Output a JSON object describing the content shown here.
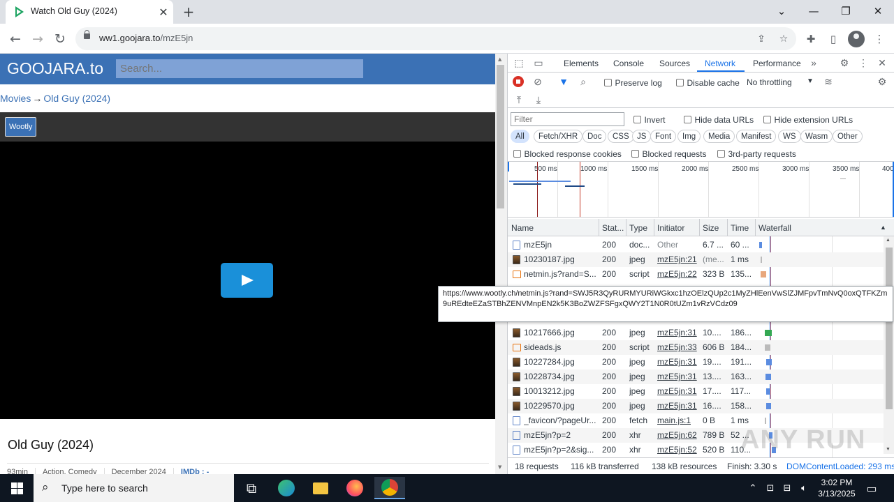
{
  "browser": {
    "tab_title": "Watch Old Guy (2024)",
    "url_host": "ww1.goojara.to",
    "url_path": "/mzE5jn"
  },
  "page": {
    "logo": "GOOJARA.to",
    "search_placeholder": "Search...",
    "breadcrumb_root": "Movies",
    "breadcrumb_arrow": "→",
    "breadcrumb_current": "Old Guy (2024)",
    "server_label": "Wootly",
    "movie_title": "Old Guy (2024)",
    "meta": {
      "runtime": "93min",
      "genres": "Action, Comedy",
      "release": "December 2024",
      "imdb": "IMDb : -"
    }
  },
  "devtools": {
    "tabs": [
      "Elements",
      "Console",
      "Sources",
      "Network",
      "Performance"
    ],
    "active_tab": "Network",
    "preserve_log": "Preserve log",
    "disable_cache": "Disable cache",
    "throttling": "No throttling",
    "filter_placeholder": "Filter",
    "invert": "Invert",
    "hide_data_urls": "Hide data URLs",
    "hide_extension_urls": "Hide extension URLs",
    "type_filters": [
      "All",
      "Fetch/XHR",
      "Doc",
      "CSS",
      "JS",
      "Font",
      "Img",
      "Media",
      "Manifest",
      "WS",
      "Wasm",
      "Other"
    ],
    "blocked_response_cookies": "Blocked response cookies",
    "blocked_requests": "Blocked requests",
    "third_party_requests": "3rd-party requests",
    "timeline_ticks": [
      "500 ms",
      "1000 ms",
      "1500 ms",
      "2000 ms",
      "2500 ms",
      "3000 ms",
      "3500 ms",
      "400"
    ],
    "columns": [
      "Name",
      "Stat...",
      "Type",
      "Initiator",
      "Size",
      "Time",
      "Waterfall"
    ],
    "rows": [
      {
        "name": "mzE5jn",
        "status": "200",
        "type": "doc...",
        "initiator": "Other",
        "size": "6.7 ...",
        "time": "60 ...",
        "icon": "doc"
      },
      {
        "name": "10230187.jpg",
        "status": "200",
        "type": "jpeg",
        "initiator": "mzE5jn:21",
        "size": "(me...",
        "time": "1 ms",
        "icon": "img"
      },
      {
        "name": "netmin.js?rand=S...",
        "status": "200",
        "type": "script",
        "initiator": "mzE5jn:22",
        "size": "323 B",
        "time": "135...",
        "icon": "script"
      },
      {
        "name": "10217666.jpg",
        "status": "200",
        "type": "jpeg",
        "initiator": "mzE5jn:31",
        "size": "10....",
        "time": "186...",
        "icon": "img"
      },
      {
        "name": "sideads.js",
        "status": "200",
        "type": "script",
        "initiator": "mzE5jn:33",
        "size": "606 B",
        "time": "184...",
        "icon": "script"
      },
      {
        "name": "10227284.jpg",
        "status": "200",
        "type": "jpeg",
        "initiator": "mzE5jn:31",
        "size": "19....",
        "time": "191...",
        "icon": "img"
      },
      {
        "name": "10228734.jpg",
        "status": "200",
        "type": "jpeg",
        "initiator": "mzE5jn:31",
        "size": "13....",
        "time": "163...",
        "icon": "img"
      },
      {
        "name": "10013212.jpg",
        "status": "200",
        "type": "jpeg",
        "initiator": "mzE5jn:31",
        "size": "17....",
        "time": "117...",
        "icon": "img"
      },
      {
        "name": "10229570.jpg",
        "status": "200",
        "type": "jpeg",
        "initiator": "mzE5jn:31",
        "size": "16....",
        "time": "158...",
        "icon": "img"
      },
      {
        "name": "_favicon/?pageUr...",
        "status": "200",
        "type": "fetch",
        "initiator": "main.js:1",
        "size": "0 B",
        "time": "1 ms",
        "icon": "doc"
      },
      {
        "name": "mzE5jn?p=2",
        "status": "200",
        "type": "xhr",
        "initiator": "mzE5jn:62",
        "size": "789 B",
        "time": "52 ...",
        "icon": "doc"
      },
      {
        "name": "mzE5jn?p=2&sig...",
        "status": "200",
        "type": "xhr",
        "initiator": "mzE5jn:52",
        "size": "520 B",
        "time": "110...",
        "icon": "doc"
      }
    ],
    "tooltip_url": "https://www.wootly.ch/netmin.js?rand=SWJ5R3QyRURMYURiWGkxc1hzOElzQUp2c1MyZHlEenVwSlZJMFpvTmNvQ0oxQTFKZm9uREdteEZaSTBhZENVMnpEN2k5K3BoZWZFSFgxQWY2T1N0R0tUZm1vRzVCdz09",
    "status": {
      "requests": "18 requests",
      "transferred": "116 kB transferred",
      "resources": "138 kB resources",
      "finish": "Finish: 3.30 s",
      "dcl": "DOMContentLoaded: 293 ms"
    }
  },
  "taskbar": {
    "search_placeholder": "Type here to search",
    "time": "3:02 PM",
    "date": "3/13/2025"
  },
  "watermark": "ANY RUN"
}
